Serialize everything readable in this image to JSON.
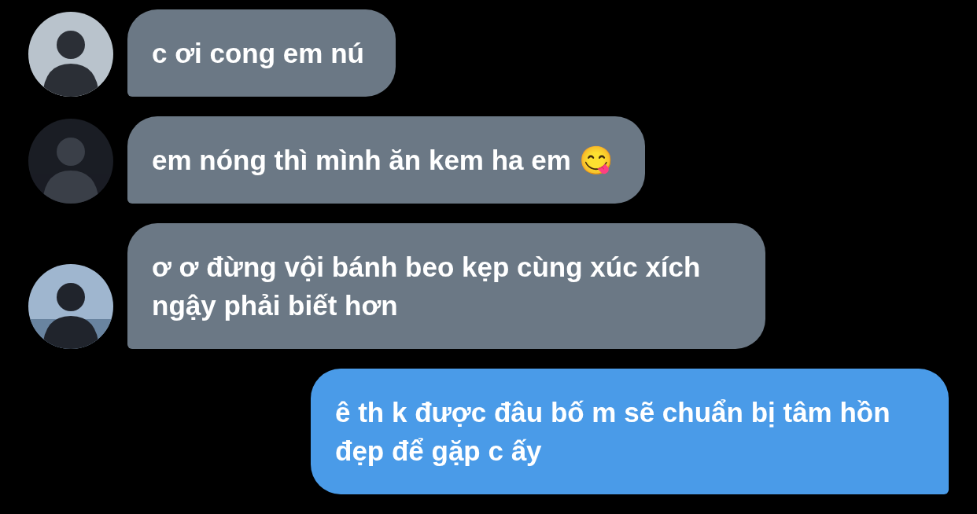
{
  "messages": [
    {
      "kind": "incoming",
      "text": "c ơi cong em nú"
    },
    {
      "kind": "incoming",
      "text": "em nóng thì mình ăn kem ha em 😋"
    },
    {
      "kind": "incoming",
      "text": "ơ ơ đừng vội bánh beo kẹp cùng xúc xích ngậy phải biết hơn"
    },
    {
      "kind": "outgoing",
      "text": "ê th k được đâu bố m sẽ chuẩn bị tâm hồn đẹp để gặp c ấy"
    }
  ]
}
